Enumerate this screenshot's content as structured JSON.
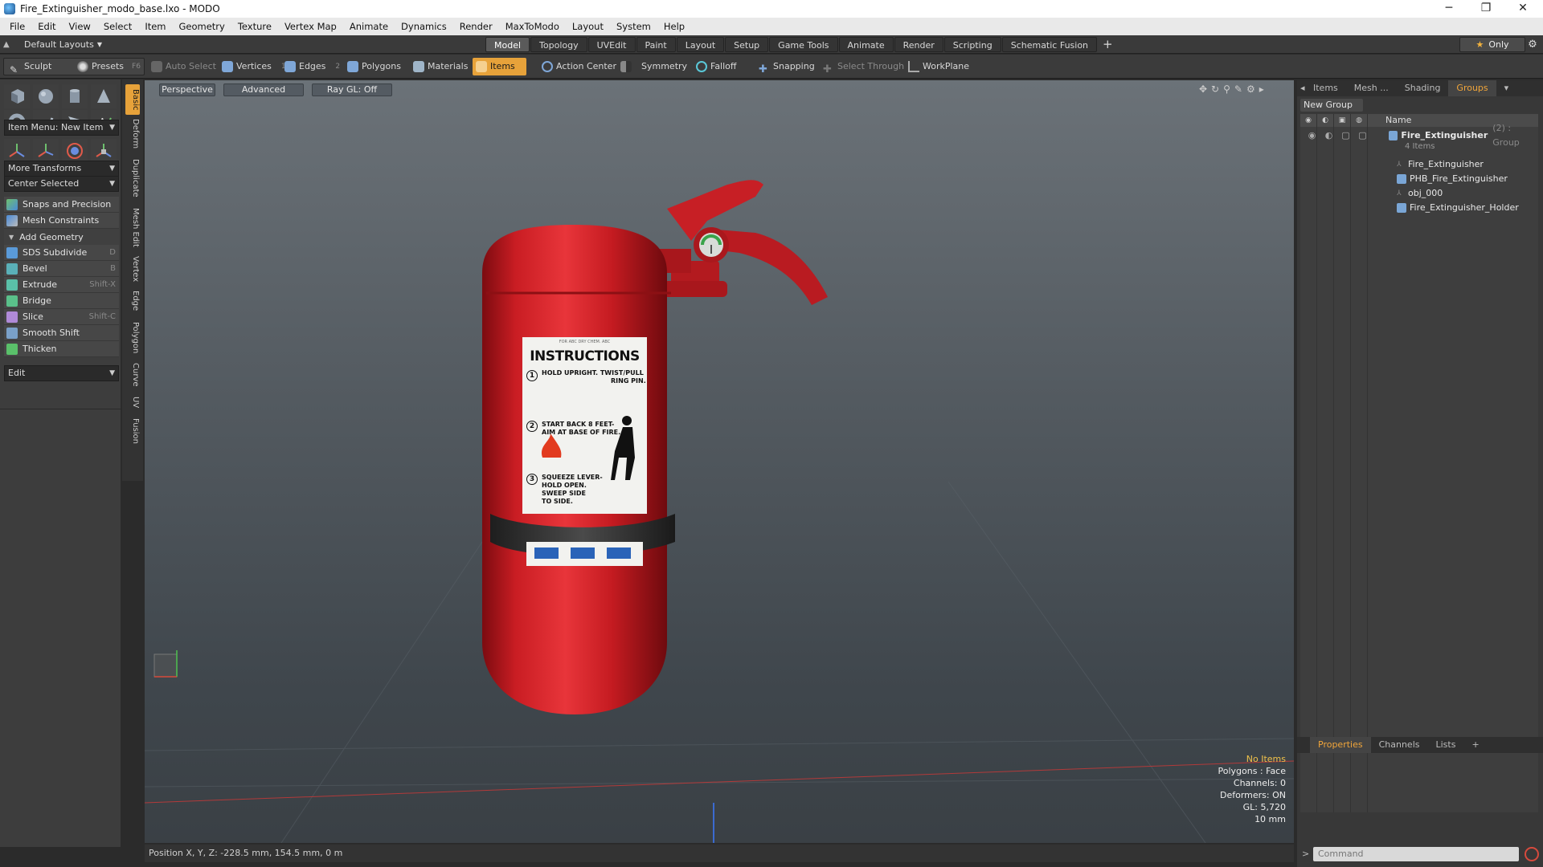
{
  "window": {
    "title": "Fire_Extinguisher_modo_base.lxo - MODO",
    "minimize": "─",
    "maximize": "❐",
    "close": "✕"
  },
  "menu": [
    "File",
    "Edit",
    "View",
    "Select",
    "Item",
    "Geometry",
    "Texture",
    "Vertex Map",
    "Animate",
    "Dynamics",
    "Render",
    "MaxToModo",
    "Layout",
    "System",
    "Help"
  ],
  "layout_bar": {
    "dropdown": "Default Layouts",
    "tabs": [
      "Model",
      "Topology",
      "UVEdit",
      "Paint",
      "Layout",
      "Setup",
      "Game Tools",
      "Animate",
      "Render",
      "Scripting",
      "Schematic Fusion"
    ],
    "active_tab": "Model",
    "plus": "+",
    "only": "Only"
  },
  "toolbar": {
    "sculpt": "Sculpt",
    "presets": "Presets",
    "presets_key": "F6",
    "auto_select": "Auto Select",
    "vertices": "Vertices",
    "vertices_num": "1",
    "edges": "Edges",
    "edges_num": "2",
    "polygons": "Polygons",
    "materials": "Materials",
    "items": "Items",
    "action_center": "Action Center",
    "symmetry": "Symmetry",
    "falloff": "Falloff",
    "snapping": "Snapping",
    "select_through": "Select Through",
    "workplane": "WorkPlane"
  },
  "left_panel": {
    "item_menu": "Item Menu: New Item",
    "more_transforms": "More Transforms",
    "center_selected": "Center Selected",
    "snaps": "Snaps and Precision",
    "mesh_constraints": "Mesh Constraints",
    "add_geometry": "Add Geometry",
    "tools": [
      {
        "label": "SDS Subdivide",
        "shortcut": "D"
      },
      {
        "label": "Bevel",
        "shortcut": "B"
      },
      {
        "label": "Extrude",
        "shortcut": "Shift-X"
      },
      {
        "label": "Bridge",
        "shortcut": ""
      },
      {
        "label": "Slice",
        "shortcut": "Shift-C"
      },
      {
        "label": "Smooth Shift",
        "shortcut": ""
      },
      {
        "label": "Thicken",
        "shortcut": ""
      }
    ],
    "edit": "Edit"
  },
  "vertical_tabs": [
    "Basic",
    "Deform",
    "Duplicate",
    "Mesh Edit",
    "Vertex",
    "Edge",
    "Polygon",
    "Curve",
    "UV",
    "Fusion"
  ],
  "viewport": {
    "perspective": "Perspective",
    "advanced": "Advanced",
    "raygl": "Ray GL: Off",
    "stats": [
      "No Items",
      "Polygons : Face",
      "Channels: 0",
      "Deformers: ON",
      "GL: 5,720",
      "10 mm"
    ],
    "label": {
      "top": "FOR ABC DRY CHEM. ABC",
      "title": "INSTRUCTIONS",
      "step1a": "HOLD UPRIGHT. TWIST/PULL",
      "step1b": "RING PIN.",
      "step2a": "START BACK 8 FEET-",
      "step2b": "AIM AT BASE OF FIRE.",
      "step3a": "SQUEEZE LEVER-",
      "step3b": "HOLD OPEN.",
      "step3c": "SWEEP SIDE",
      "step3d": "TO SIDE.",
      "n1": "1",
      "n2": "2",
      "n3": "3"
    }
  },
  "status": {
    "position": "Position X, Y, Z:   -228.5 mm, 154.5 mm, 0 m"
  },
  "right_panel": {
    "tabs": [
      "Items",
      "Mesh ...",
      "Shading",
      "Groups"
    ],
    "active_tab": "Groups",
    "new_group": "New Group",
    "col_name": "Name",
    "group_name": "Fire_Extinguisher",
    "group_suffix": "(2) : Group",
    "group_count": "4 Items",
    "children": [
      "Fire_Extinguisher",
      "PHB_Fire_Extinguisher",
      "obj_000",
      "Fire_Extinguisher_Holder"
    ],
    "bottom_tabs": [
      "Properties",
      "Channels",
      "Lists",
      "+"
    ],
    "command_placeholder": "Command",
    "prompt": ">"
  },
  "colors": {
    "accent": "#e7a23a",
    "extinguisher_red": "#d42025"
  }
}
